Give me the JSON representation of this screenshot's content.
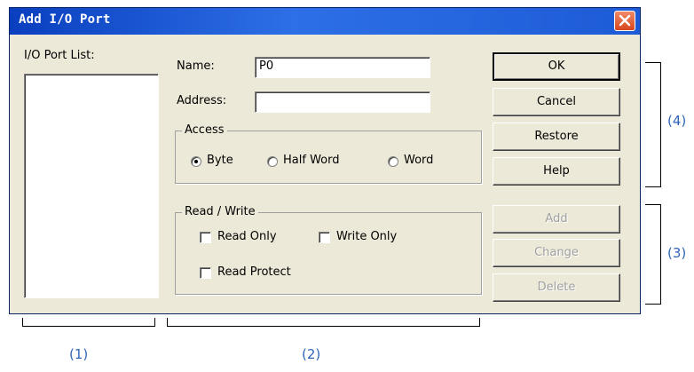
{
  "window": {
    "title": "Add I/O Port"
  },
  "list": {
    "label": "I/O Port List:"
  },
  "fields": {
    "name_label": "Name:",
    "name_value": "P0",
    "address_label": "Address:",
    "address_value": ""
  },
  "access": {
    "title": "Access",
    "options": [
      {
        "label": "Byte",
        "checked": true
      },
      {
        "label": "Half Word",
        "checked": false
      },
      {
        "label": "Word",
        "checked": false
      }
    ]
  },
  "readwrite": {
    "title": "Read / Write",
    "read_only": "Read Only",
    "write_only": "Write Only",
    "read_protect": "Read Protect"
  },
  "buttons": {
    "ok": "OK",
    "cancel": "Cancel",
    "restore": "Restore",
    "help": "Help",
    "add": "Add",
    "change": "Change",
    "delete": "Delete"
  },
  "annotations": {
    "a1": "(1)",
    "a2": "(2)",
    "a3": "(3)",
    "a4": "(4)"
  },
  "colors": {
    "titlebar": "#0a3fbf",
    "dialog_bg": "#ece9d8",
    "annotation": "#2f66b8"
  }
}
